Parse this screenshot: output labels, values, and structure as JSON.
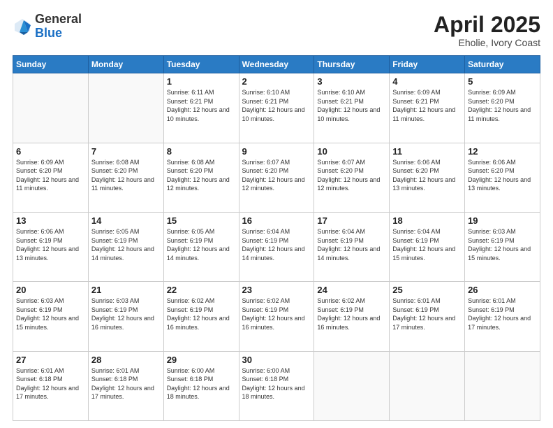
{
  "header": {
    "logo_general": "General",
    "logo_blue": "Blue",
    "title": "April 2025",
    "location": "Eholie, Ivory Coast"
  },
  "calendar": {
    "days_of_week": [
      "Sunday",
      "Monday",
      "Tuesday",
      "Wednesday",
      "Thursday",
      "Friday",
      "Saturday"
    ],
    "weeks": [
      [
        {
          "day": "",
          "detail": ""
        },
        {
          "day": "",
          "detail": ""
        },
        {
          "day": "1",
          "detail": "Sunrise: 6:11 AM\nSunset: 6:21 PM\nDaylight: 12 hours and 10 minutes."
        },
        {
          "day": "2",
          "detail": "Sunrise: 6:10 AM\nSunset: 6:21 PM\nDaylight: 12 hours and 10 minutes."
        },
        {
          "day": "3",
          "detail": "Sunrise: 6:10 AM\nSunset: 6:21 PM\nDaylight: 12 hours and 10 minutes."
        },
        {
          "day": "4",
          "detail": "Sunrise: 6:09 AM\nSunset: 6:21 PM\nDaylight: 12 hours and 11 minutes."
        },
        {
          "day": "5",
          "detail": "Sunrise: 6:09 AM\nSunset: 6:20 PM\nDaylight: 12 hours and 11 minutes."
        }
      ],
      [
        {
          "day": "6",
          "detail": "Sunrise: 6:09 AM\nSunset: 6:20 PM\nDaylight: 12 hours and 11 minutes."
        },
        {
          "day": "7",
          "detail": "Sunrise: 6:08 AM\nSunset: 6:20 PM\nDaylight: 12 hours and 11 minutes."
        },
        {
          "day": "8",
          "detail": "Sunrise: 6:08 AM\nSunset: 6:20 PM\nDaylight: 12 hours and 12 minutes."
        },
        {
          "day": "9",
          "detail": "Sunrise: 6:07 AM\nSunset: 6:20 PM\nDaylight: 12 hours and 12 minutes."
        },
        {
          "day": "10",
          "detail": "Sunrise: 6:07 AM\nSunset: 6:20 PM\nDaylight: 12 hours and 12 minutes."
        },
        {
          "day": "11",
          "detail": "Sunrise: 6:06 AM\nSunset: 6:20 PM\nDaylight: 12 hours and 13 minutes."
        },
        {
          "day": "12",
          "detail": "Sunrise: 6:06 AM\nSunset: 6:20 PM\nDaylight: 12 hours and 13 minutes."
        }
      ],
      [
        {
          "day": "13",
          "detail": "Sunrise: 6:06 AM\nSunset: 6:19 PM\nDaylight: 12 hours and 13 minutes."
        },
        {
          "day": "14",
          "detail": "Sunrise: 6:05 AM\nSunset: 6:19 PM\nDaylight: 12 hours and 14 minutes."
        },
        {
          "day": "15",
          "detail": "Sunrise: 6:05 AM\nSunset: 6:19 PM\nDaylight: 12 hours and 14 minutes."
        },
        {
          "day": "16",
          "detail": "Sunrise: 6:04 AM\nSunset: 6:19 PM\nDaylight: 12 hours and 14 minutes."
        },
        {
          "day": "17",
          "detail": "Sunrise: 6:04 AM\nSunset: 6:19 PM\nDaylight: 12 hours and 14 minutes."
        },
        {
          "day": "18",
          "detail": "Sunrise: 6:04 AM\nSunset: 6:19 PM\nDaylight: 12 hours and 15 minutes."
        },
        {
          "day": "19",
          "detail": "Sunrise: 6:03 AM\nSunset: 6:19 PM\nDaylight: 12 hours and 15 minutes."
        }
      ],
      [
        {
          "day": "20",
          "detail": "Sunrise: 6:03 AM\nSunset: 6:19 PM\nDaylight: 12 hours and 15 minutes."
        },
        {
          "day": "21",
          "detail": "Sunrise: 6:03 AM\nSunset: 6:19 PM\nDaylight: 12 hours and 16 minutes."
        },
        {
          "day": "22",
          "detail": "Sunrise: 6:02 AM\nSunset: 6:19 PM\nDaylight: 12 hours and 16 minutes."
        },
        {
          "day": "23",
          "detail": "Sunrise: 6:02 AM\nSunset: 6:19 PM\nDaylight: 12 hours and 16 minutes."
        },
        {
          "day": "24",
          "detail": "Sunrise: 6:02 AM\nSunset: 6:19 PM\nDaylight: 12 hours and 16 minutes."
        },
        {
          "day": "25",
          "detail": "Sunrise: 6:01 AM\nSunset: 6:19 PM\nDaylight: 12 hours and 17 minutes."
        },
        {
          "day": "26",
          "detail": "Sunrise: 6:01 AM\nSunset: 6:19 PM\nDaylight: 12 hours and 17 minutes."
        }
      ],
      [
        {
          "day": "27",
          "detail": "Sunrise: 6:01 AM\nSunset: 6:18 PM\nDaylight: 12 hours and 17 minutes."
        },
        {
          "day": "28",
          "detail": "Sunrise: 6:01 AM\nSunset: 6:18 PM\nDaylight: 12 hours and 17 minutes."
        },
        {
          "day": "29",
          "detail": "Sunrise: 6:00 AM\nSunset: 6:18 PM\nDaylight: 12 hours and 18 minutes."
        },
        {
          "day": "30",
          "detail": "Sunrise: 6:00 AM\nSunset: 6:18 PM\nDaylight: 12 hours and 18 minutes."
        },
        {
          "day": "",
          "detail": ""
        },
        {
          "day": "",
          "detail": ""
        },
        {
          "day": "",
          "detail": ""
        }
      ]
    ]
  }
}
